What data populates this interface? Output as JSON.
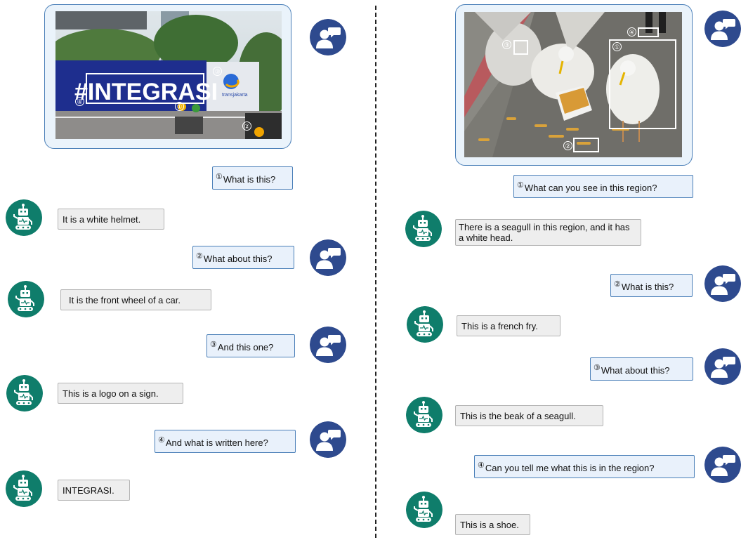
{
  "left": {
    "image": {
      "sign_text": "#INTEGRASI",
      "logo_text": "transjakarta",
      "region_markers": [
        "①",
        "②",
        "③",
        "④"
      ]
    },
    "turns": [
      {
        "num": "①",
        "question": "What is this?",
        "answer": "It is a white helmet."
      },
      {
        "num": "②",
        "question": "What about this?",
        "answer": "It is the front wheel of a car."
      },
      {
        "num": "③",
        "question": "And this one?",
        "answer": "This is a logo on a sign."
      },
      {
        "num": "④",
        "question": "And what is written here?",
        "answer": "INTEGRASI."
      }
    ]
  },
  "right": {
    "image": {
      "region_markers": [
        "①",
        "②",
        "③",
        "④"
      ]
    },
    "turns": [
      {
        "num": "①",
        "question": "What can you see in this region?",
        "answer": "There is a seagull in this region, and it has a white head."
      },
      {
        "num": "②",
        "question": "What is this?",
        "answer": "This is a french fry."
      },
      {
        "num": "③",
        "question": "What about this?",
        "answer": "This is the beak of a seagull."
      },
      {
        "num": "④",
        "question": "Can you tell me what this is in the region?",
        "answer": "This is a shoe."
      }
    ]
  },
  "icons": {
    "user": "user-chat-icon",
    "robot": "robot-icon"
  },
  "colors": {
    "user_avatar": "#2e4a8e",
    "robot_avatar": "#0f7d6b",
    "question_bg": "#e9f1fb",
    "question_border": "#4a7fb8",
    "answer_bg": "#eeeeee",
    "answer_border": "#b4b4b4"
  }
}
